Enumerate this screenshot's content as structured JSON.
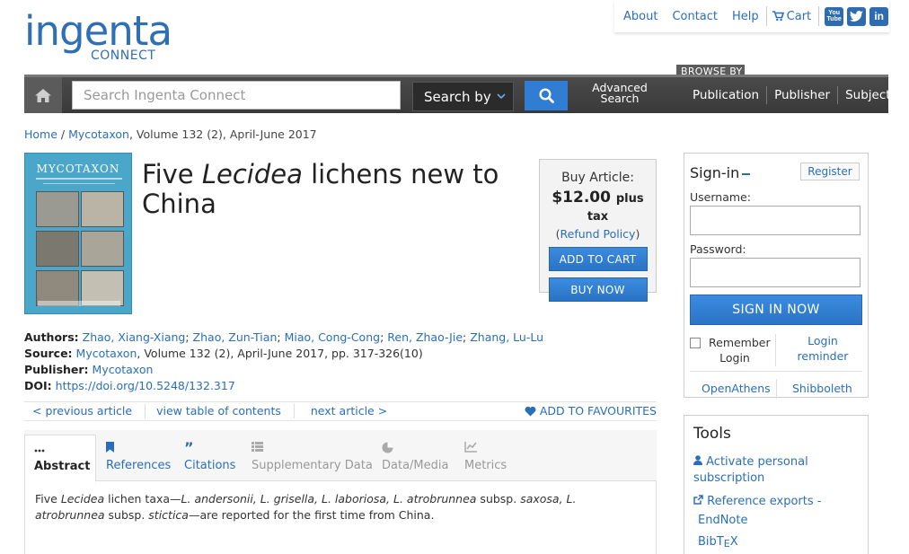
{
  "logo": {
    "main": "ingenta",
    "sub": "CONNECT"
  },
  "toplinks": {
    "about": "About",
    "contact": "Contact",
    "help": "Help",
    "cart": "Cart"
  },
  "social": {
    "youtube": "You Tube",
    "twitter": "t",
    "linkedin": "in"
  },
  "nav": {
    "browse_by": "BROWSE BY",
    "search_placeholder": "Search Ingenta Connect",
    "search_by": "Search by",
    "advanced_line1": "Advanced",
    "advanced_line2": "Search",
    "publication": "Publication",
    "publisher": "Publisher",
    "subject": "Subject"
  },
  "breadcrumb": {
    "home": "Home",
    "sep": " / ",
    "journal": "Mycotaxon",
    "rest": ", Volume 132 (2), April-June 2017"
  },
  "cover": {
    "title": "MYCOTAXON"
  },
  "article": {
    "title_pre": "Five ",
    "title_italic": "Lecidea",
    "title_post": " lichens new to China"
  },
  "buy": {
    "label": "Buy Article:",
    "price": "$12.00",
    "tax": "plus tax",
    "refund_open": "(",
    "refund": "Refund Policy",
    "refund_close": ")",
    "add_to_cart": "ADD TO CART",
    "buy_now": "BUY NOW"
  },
  "meta": {
    "authors_label": "Authors:",
    "authors": [
      "Zhao, Xiang-Xiang",
      "Zhao, Zun-Tian",
      "Miao, Cong-Cong",
      "Ren, Zhao-Jie",
      "Zhang, Lu-Lu"
    ],
    "author_sep": "; ",
    "source_label": "Source:",
    "source_journal": "Mycotaxon",
    "source_rest": ", Volume 132 (2), April-June 2017, pp. 317-326(10)",
    "publisher_label": "Publisher:",
    "publisher": "Mycotaxon",
    "doi_label": "DOI:",
    "doi": "https://doi.org/10.5248/132.317"
  },
  "pn": {
    "prev": "< previous article",
    "toc": "view table of contents",
    "next": "next article >",
    "fav": "ADD TO FAVOURITES"
  },
  "tabs": {
    "abstract": "Abstract",
    "references": "References",
    "citations": "Citations",
    "supplementary": "Supplementary Data",
    "datamedia": "Data/Media",
    "metrics": "Metrics"
  },
  "abstract": {
    "p1": "Five ",
    "i1": "Lecidea",
    "p2": " lichen taxa—",
    "i2": "L. andersonii, L. grisella, L. laboriosa, L. atrobrunnea",
    "p3": " subsp. ",
    "i3": "saxosa, L. atrobrunnea",
    "p4": " subsp. ",
    "i4": "stictica",
    "p5": "—are reported for the first time from China."
  },
  "signin": {
    "title": "Sign-in",
    "register": "Register",
    "username": "Username:",
    "password": "Password:",
    "button": "SIGN IN NOW",
    "remember1": "Remember",
    "remember2": "Login",
    "reminder1": "Login",
    "reminder2": "reminder",
    "openathens": "OpenAthens",
    "shibboleth": "Shibboleth"
  },
  "tools": {
    "title": "Tools",
    "activate1": "Activate personal",
    "activate2": "subscription",
    "export": "Reference exports -",
    "endnote": "EndNote",
    "bibtex_b": "BibT",
    "bibtex_e": "E",
    "bibtex_x": "X"
  },
  "colors": {
    "brand_blue": "#2f6fb5",
    "link": "#2a6ebb",
    "nav_dark": "#3f3f3f"
  }
}
